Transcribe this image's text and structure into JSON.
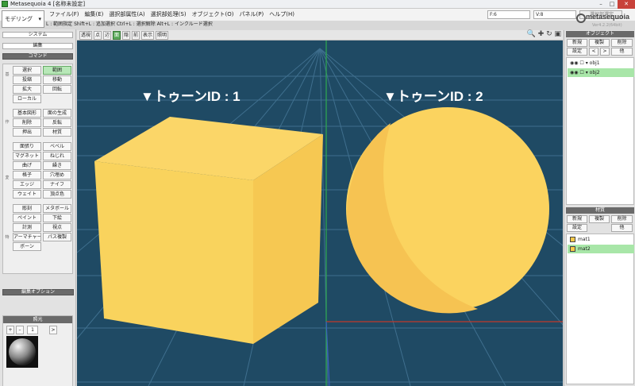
{
  "window": {
    "title": "Metasequoia 4 [名称未設定]",
    "minimize": "–",
    "maximize": "□",
    "close": "✕"
  },
  "mode_select": {
    "value": "モデリング",
    "arrow": "▾"
  },
  "menu": [
    "ファイル(F)",
    "編集(E)",
    "選択部属性(A)",
    "選択部処理(S)",
    "オブジェクト(O)",
    "パネル(P)",
    "ヘルプ(H)"
  ],
  "hint": "L : 範囲指定  Shift+L : 追加選択  Ctrl+L : 選択解除  Alt+L : インクルード選択",
  "fields": {
    "f": "F:6",
    "v": "V:8",
    "sel_button": "選択部選定"
  },
  "logo": {
    "name": "metasequoia",
    "version": "Ver4.2.2(64bit)",
    "brand_color": "#3a9a3a"
  },
  "left": {
    "system": "システム",
    "edit": "編集",
    "command": "コマンド",
    "groups": {
      "g1": "基",
      "g2": "作",
      "g3": "変",
      "g4": "特"
    },
    "commands": {
      "select": "選択",
      "range": "範囲",
      "project": "投縮",
      "move": "移動",
      "scale": "拡大",
      "rotate": "回転",
      "local": "ローカル",
      "basic": "基本図形",
      "face": "面の生成",
      "delete": "削除",
      "flip": "反転",
      "extrude": "押出",
      "material": "材質",
      "paint": "面張り",
      "bevel": "ベベル",
      "magnet": "マグネット",
      "twist": "ねじれ",
      "curve": "曲げ",
      "drill": "繰き",
      "lattice": "格子",
      "hole": "穴埋め",
      "edge": "エッジ",
      "knife": "ナイフ",
      "weight": "ウェイト",
      "vcolor": "頂点色",
      "sculpt": "彫刻",
      "metaball": "メタボール",
      "pbrush": "ペイント",
      "underlay": "下絵",
      "measure": "計測",
      "viewpoint": "視点",
      "armature": "アーマチャー",
      "pathcopy": "パス複製",
      "bone": "ボーン"
    },
    "edit_options": "編集オプション",
    "mat_title": "照光",
    "mat_plus": "+",
    "mat_minus": "–",
    "mat_counter": "1",
    "mat_next": ">",
    "mat_check_label": "逆光",
    "mat_color_btn": "色"
  },
  "viewtoolbar": {
    "buttons": [
      "透視",
      "点",
      "辺",
      "面",
      "隠",
      "前",
      "表示",
      "照明"
    ],
    "icons": "🔍 ✚ ↻ ▣"
  },
  "viewport": {
    "label1": "▼トゥーンID : 1",
    "label2": "▼トゥーンID : 2",
    "bg_color": "#1f4a64",
    "object_color": "#fbd35f"
  },
  "objects_panel": {
    "title": "オブジェクト",
    "buttons": [
      "新規",
      "複製",
      "削除"
    ],
    "nav": [
      "設定",
      "<",
      ">",
      "他"
    ],
    "items": [
      "obj1",
      "obj2"
    ],
    "selected": "obj2"
  },
  "materials_panel": {
    "title": "材質",
    "buttons": [
      "新規",
      "複製",
      "削除"
    ],
    "nav": [
      "設定",
      "他"
    ],
    "items": [
      "mat1",
      "mat2"
    ],
    "selected": "mat2",
    "swatch": "#f7c94a"
  }
}
